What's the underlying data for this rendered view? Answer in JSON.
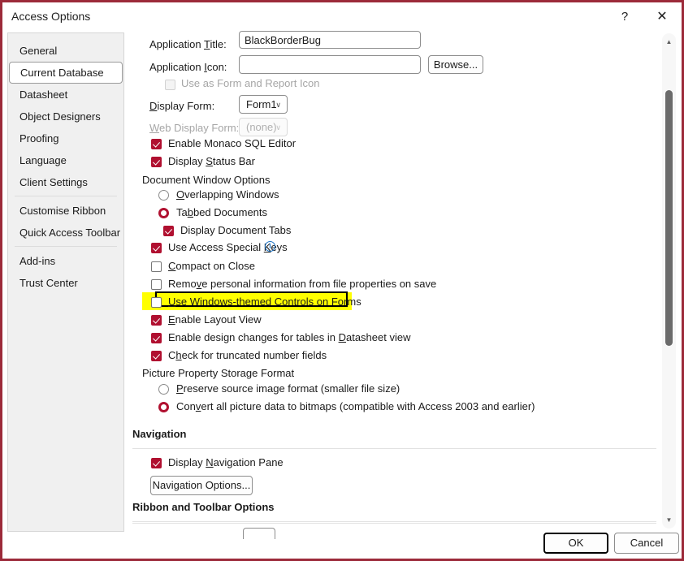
{
  "window": {
    "title": "Access Options",
    "help_label": "?",
    "close_label": "✕",
    "accent_color": "#9c2a3a"
  },
  "sidebar": {
    "items": [
      {
        "label": "General",
        "selected": false
      },
      {
        "label": "Current Database",
        "selected": true
      },
      {
        "label": "Datasheet",
        "selected": false
      },
      {
        "label": "Object Designers",
        "selected": false
      },
      {
        "label": "Proofing",
        "selected": false
      },
      {
        "label": "Language",
        "selected": false
      },
      {
        "label": "Client Settings",
        "selected": false
      },
      {
        "label": "Customise Ribbon",
        "selected": false
      },
      {
        "label": "Quick Access Toolbar",
        "selected": false
      },
      {
        "label": "Add-ins",
        "selected": false
      },
      {
        "label": "Trust Center",
        "selected": false
      }
    ]
  },
  "fields": {
    "app_title_label": "Application Title:",
    "app_title_value": "BlackBorderBug",
    "app_title_placeholder": "",
    "app_icon_label": "Application Icon:",
    "app_icon_value": "",
    "app_icon_placeholder": "",
    "browse_label": "Browse...",
    "use_as_form_report_icon_label": "Use as Form and Report Icon",
    "display_form_label": "Display Form:",
    "display_form_value": "Form1",
    "web_display_form_label": "Web Display Form:",
    "web_display_form_value": "(none)",
    "caret_glyph": "∨"
  },
  "checkboxes": {
    "enable_monaco": {
      "label": "Enable Monaco SQL Editor",
      "checked": true
    },
    "display_status_bar": {
      "label": "Display Status Bar",
      "checked": true
    },
    "display_document_tabs": {
      "label": "Display Document Tabs",
      "checked": true
    },
    "use_access_special_keys": {
      "label": "Use Access Special Keys",
      "checked": true
    },
    "compact_on_close": {
      "label": "Compact on Close",
      "checked": false
    },
    "remove_personal_info": {
      "label": "Remove personal information from file properties on save",
      "checked": false
    },
    "use_windows_themed": {
      "label": "Use Windows-themed Controls on Forms",
      "checked": false
    },
    "enable_layout_view": {
      "label": "Enable Layout View",
      "checked": true
    },
    "enable_design_changes": {
      "label": "Enable design changes for tables in Datasheet view",
      "checked": true
    },
    "check_truncated": {
      "label": "Check for truncated number fields",
      "checked": true
    },
    "display_nav_pane": {
      "label": "Display Navigation Pane",
      "checked": true
    }
  },
  "groups": {
    "document_window_options": {
      "heading": "Document Window Options",
      "options": [
        {
          "label": "Overlapping Windows",
          "selected": false
        },
        {
          "label": "Tabbed Documents",
          "selected": true
        }
      ]
    },
    "picture_property_storage": {
      "heading": "Picture Property Storage Format",
      "options": [
        {
          "label": "Preserve source image format (smaller file size)",
          "selected": false
        },
        {
          "label": "Convert all picture data to bitmaps (compatible with Access 2003 and earlier)",
          "selected": true
        }
      ]
    }
  },
  "sections": {
    "navigation": "Navigation",
    "ribbon_toolbar": "Ribbon and Toolbar Options"
  },
  "buttons": {
    "navigation_options": "Navigation Options...",
    "ok": "OK",
    "cancel": "Cancel"
  },
  "icons": {
    "info": "i",
    "scroll_up": "▲",
    "scroll_down": "▼"
  },
  "annotation": {
    "highlight_color": "#ffff00",
    "box_color": "#000000",
    "target": "Use Windows-themed Controls on Forms"
  }
}
